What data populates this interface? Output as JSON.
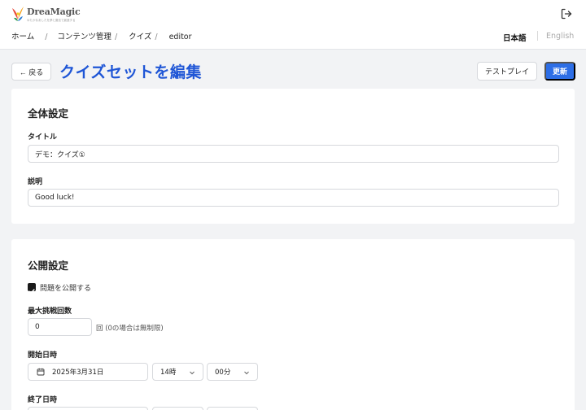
{
  "brand": {
    "name": "DreaMagic",
    "tagline": "ゆたかなあしたを夢と魔法で創造する"
  },
  "breadcrumb": [
    "ホーム",
    "コンテンツ管理",
    "クイズ",
    "editor"
  ],
  "language": {
    "ja": "日本語",
    "en": "English",
    "selected": "ja"
  },
  "toolbar": {
    "back_label": "← 戻る",
    "title": "クイズセットを編集",
    "test_play_label": "テストプレイ",
    "update_label": "更新"
  },
  "general": {
    "section_title": "全体設定",
    "title_label": "タイトル",
    "title_value": "デモ：クイズ①",
    "description_label": "説明",
    "description_value": "Good luck!"
  },
  "publish": {
    "section_title": "公開設定",
    "publish_checkbox_label": "問題を公開する",
    "publish_checked": true,
    "max_attempts_label": "最大挑戦回数",
    "max_attempts_value": "0",
    "max_attempts_suffix": "回 (0の場合は無制限)",
    "start_label": "開始日時",
    "start_date": "2025年3月31日",
    "start_hour": "14時",
    "start_minute": "00分",
    "end_label": "終了日時"
  },
  "colors": {
    "accent": "#1f56d6",
    "primary_button": "#2d6ee6",
    "background": "#f2f3f5"
  },
  "icons": [
    "logo-icon",
    "logout-icon",
    "calendar-icon",
    "chevron-down-icon"
  ]
}
